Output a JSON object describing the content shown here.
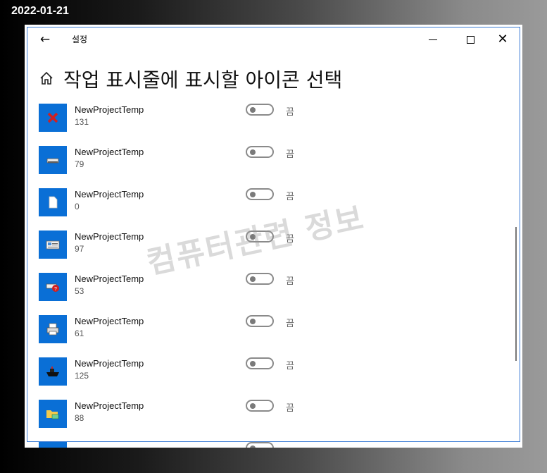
{
  "overlay": {
    "date": "2022-01-21"
  },
  "window": {
    "title": "설정",
    "heading": "작업 표시줄에 표시할 아이콘 선택",
    "watermark": "컴퓨터관련 정보"
  },
  "items": [
    {
      "name": "NewProjectTemp",
      "sub": "131",
      "state": "끔",
      "icon": "red-x-icon",
      "on": false
    },
    {
      "name": "NewProjectTemp",
      "sub": "79",
      "state": "끔",
      "icon": "drive-icon",
      "on": false
    },
    {
      "name": "NewProjectTemp",
      "sub": "0",
      "state": "끔",
      "icon": "document-icon",
      "on": false
    },
    {
      "name": "NewProjectTemp",
      "sub": "97",
      "state": "끔",
      "icon": "card-icon",
      "on": false
    },
    {
      "name": "NewProjectTemp",
      "sub": "53",
      "state": "끔",
      "icon": "help-drive-icon",
      "on": false
    },
    {
      "name": "NewProjectTemp",
      "sub": "61",
      "state": "끔",
      "icon": "printer-icon",
      "on": false
    },
    {
      "name": "NewProjectTemp",
      "sub": "125",
      "state": "끔",
      "icon": "ship-icon",
      "on": false
    },
    {
      "name": "NewProjectTemp",
      "sub": "88",
      "state": "끔",
      "icon": "folder-network-icon",
      "on": false
    }
  ]
}
